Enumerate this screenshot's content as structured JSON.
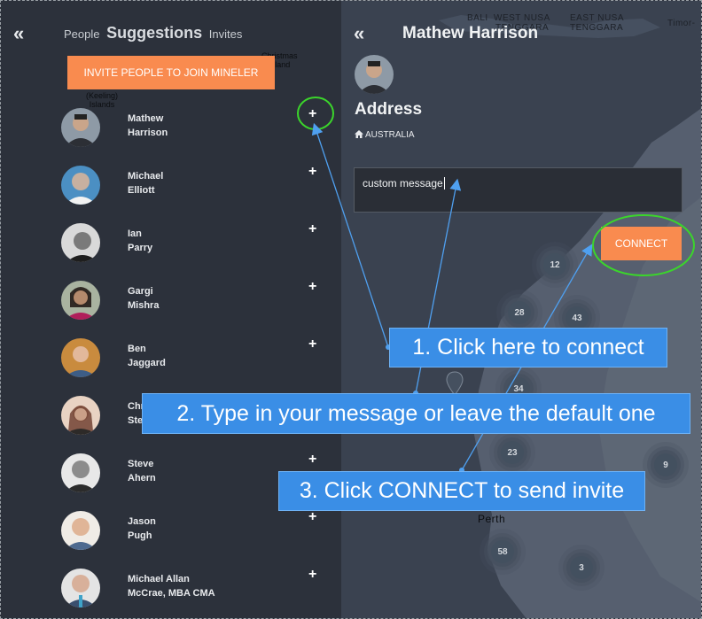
{
  "left_panel": {
    "tabs": [
      {
        "label": "People"
      },
      {
        "label": "Suggestions"
      },
      {
        "label": "Invites"
      }
    ],
    "invite_button": "INVITE PEOPLE TO JOIN MINELER",
    "people": [
      {
        "name": "Mathew\nHarrison"
      },
      {
        "name": "Michael\nElliott"
      },
      {
        "name": "Ian\nParry"
      },
      {
        "name": "Gargi\nMishra"
      },
      {
        "name": "Ben\nJaggard"
      },
      {
        "name": "Chr\nSte"
      },
      {
        "name": "Steve\nAhern"
      },
      {
        "name": "Jason\nPugh"
      },
      {
        "name": "Michael Allan\nMcCrae, MBA CMA"
      }
    ],
    "map_labels": {
      "christmas": "Christmas\nIsland",
      "keeling": "(Keeling)\nIslands"
    }
  },
  "profile": {
    "name": "Mathew Harrison",
    "section_label": "Address",
    "country": "AUSTRALIA",
    "message": "custom message",
    "connect_button": "CONNECT"
  },
  "map": {
    "labels": {
      "bali": "BALI",
      "west_nusa": "WEST NUSA",
      "tenggara": "TENGGARA",
      "east_nusa": "EAST NUSA",
      "tenggara2": "TENGGARA",
      "timor": "Timor-",
      "perth": "Perth"
    },
    "clusters": [
      "12",
      "28",
      "43",
      "34",
      "23",
      "9",
      "58",
      "3"
    ]
  },
  "annotations": {
    "step1": "1. Click here to connect",
    "step2": "2. Type in your message or leave the default one",
    "step3": "3. Click CONNECT to send invite"
  }
}
